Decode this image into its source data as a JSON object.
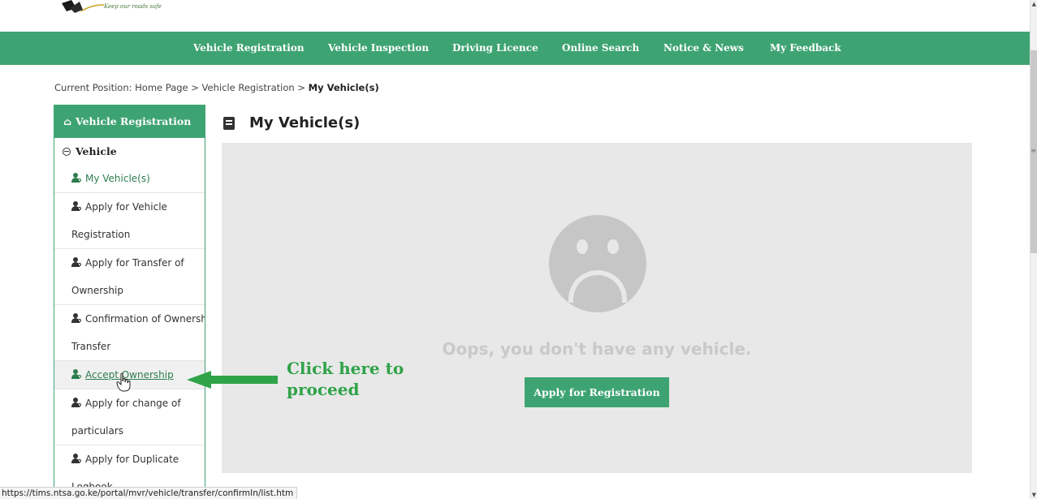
{
  "brand": {
    "tagline": "Keep our roads safe",
    "colors": {
      "primary": "#3ea372",
      "annotation": "#2fa348"
    }
  },
  "nav": {
    "items": [
      "Vehicle Registration",
      "Vehicle Inspection",
      "Driving Licence",
      "Online Search",
      "Notice & News",
      "My Feedback"
    ]
  },
  "breadcrumb": {
    "prefix": "Current Position: Home Page > Vehicle Registration > ",
    "current": "My Vehicle(s)"
  },
  "sidebar": {
    "header": "Vehicle Registration",
    "section": "Vehicle",
    "items": [
      {
        "line1": "My Vehicle(s)",
        "line2": ""
      },
      {
        "line1": "Apply for Vehicle",
        "line2": "Registration"
      },
      {
        "line1": "Apply for Transfer of",
        "line2": "Ownership"
      },
      {
        "line1": "Confirmation of Ownership",
        "line2": "Transfer"
      },
      {
        "line1": "Accept Ownership",
        "line2": ""
      },
      {
        "line1": "Apply for change of",
        "line2": "particulars"
      },
      {
        "line1": "Apply for Duplicate",
        "line2": "Logbook"
      }
    ]
  },
  "main": {
    "title": "My Vehicle(s)",
    "empty_message": "Oops, you don't have any vehicle.",
    "apply_button": "Apply for Registration"
  },
  "annotation": {
    "line1": "Click here to",
    "line2": "proceed"
  },
  "status_bar": {
    "url": "https://tims.ntsa.go.ke/portal/mvr/vehicle/transfer/confirmIn/list.htm"
  }
}
